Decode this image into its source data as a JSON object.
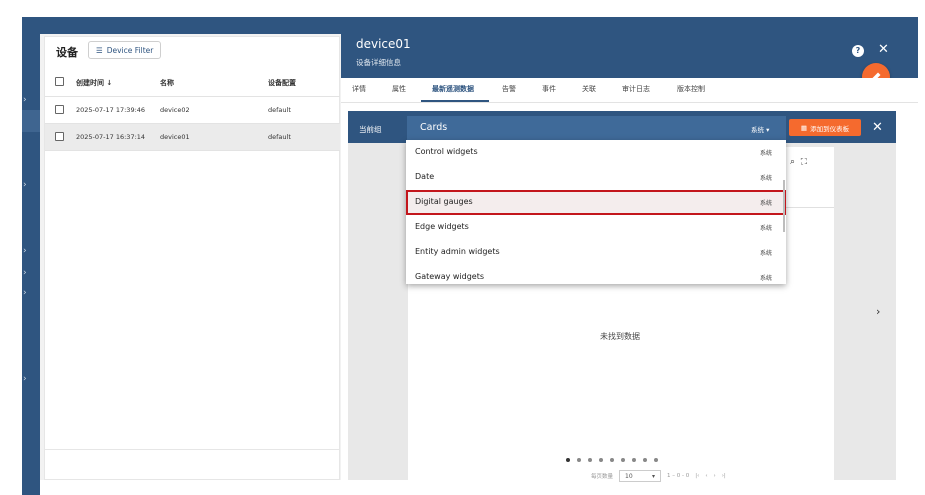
{
  "left_panel": {
    "title": "设备",
    "filter_label": "Device Filter",
    "columns": [
      "创建时间 ↓",
      "名称",
      "设备配置"
    ],
    "rows": [
      {
        "created": "2025-07-17 17:39:46",
        "name": "device02",
        "profile": "default"
      },
      {
        "created": "2025-07-17 16:37:14",
        "name": "device01",
        "profile": "default"
      }
    ]
  },
  "detail": {
    "name": "device01",
    "subtitle": "设备详细信息",
    "tabs": [
      "详情",
      "属性",
      "最新遥测数据",
      "告警",
      "事件",
      "关联",
      "审计日志",
      "版本控制"
    ],
    "active_tab": "最新遥测数据"
  },
  "dashboard_bar": {
    "current_group_label": "当前组",
    "bundle_selected": "Cards",
    "bundle_scope": "系统",
    "add_button": "添加到仪表板"
  },
  "dropdown": {
    "options": [
      {
        "name": "Control widgets",
        "scope": "系统"
      },
      {
        "name": "Date",
        "scope": "系统"
      },
      {
        "name": "Digital gauges",
        "scope": "系统"
      },
      {
        "name": "Edge widgets",
        "scope": "系统"
      },
      {
        "name": "Entity admin widgets",
        "scope": "系统"
      },
      {
        "name": "Gateway widgets",
        "scope": "系统"
      }
    ],
    "highlighted": "Digital gauges"
  },
  "canvas": {
    "empty_text": "未找到数据",
    "page_size_label": "每页数量",
    "page_size": "10",
    "range": "1 – 0 - 0"
  },
  "colors": {
    "primary": "#2f5580",
    "accent": "#f56a2e",
    "highlight_border": "#c3161c"
  }
}
